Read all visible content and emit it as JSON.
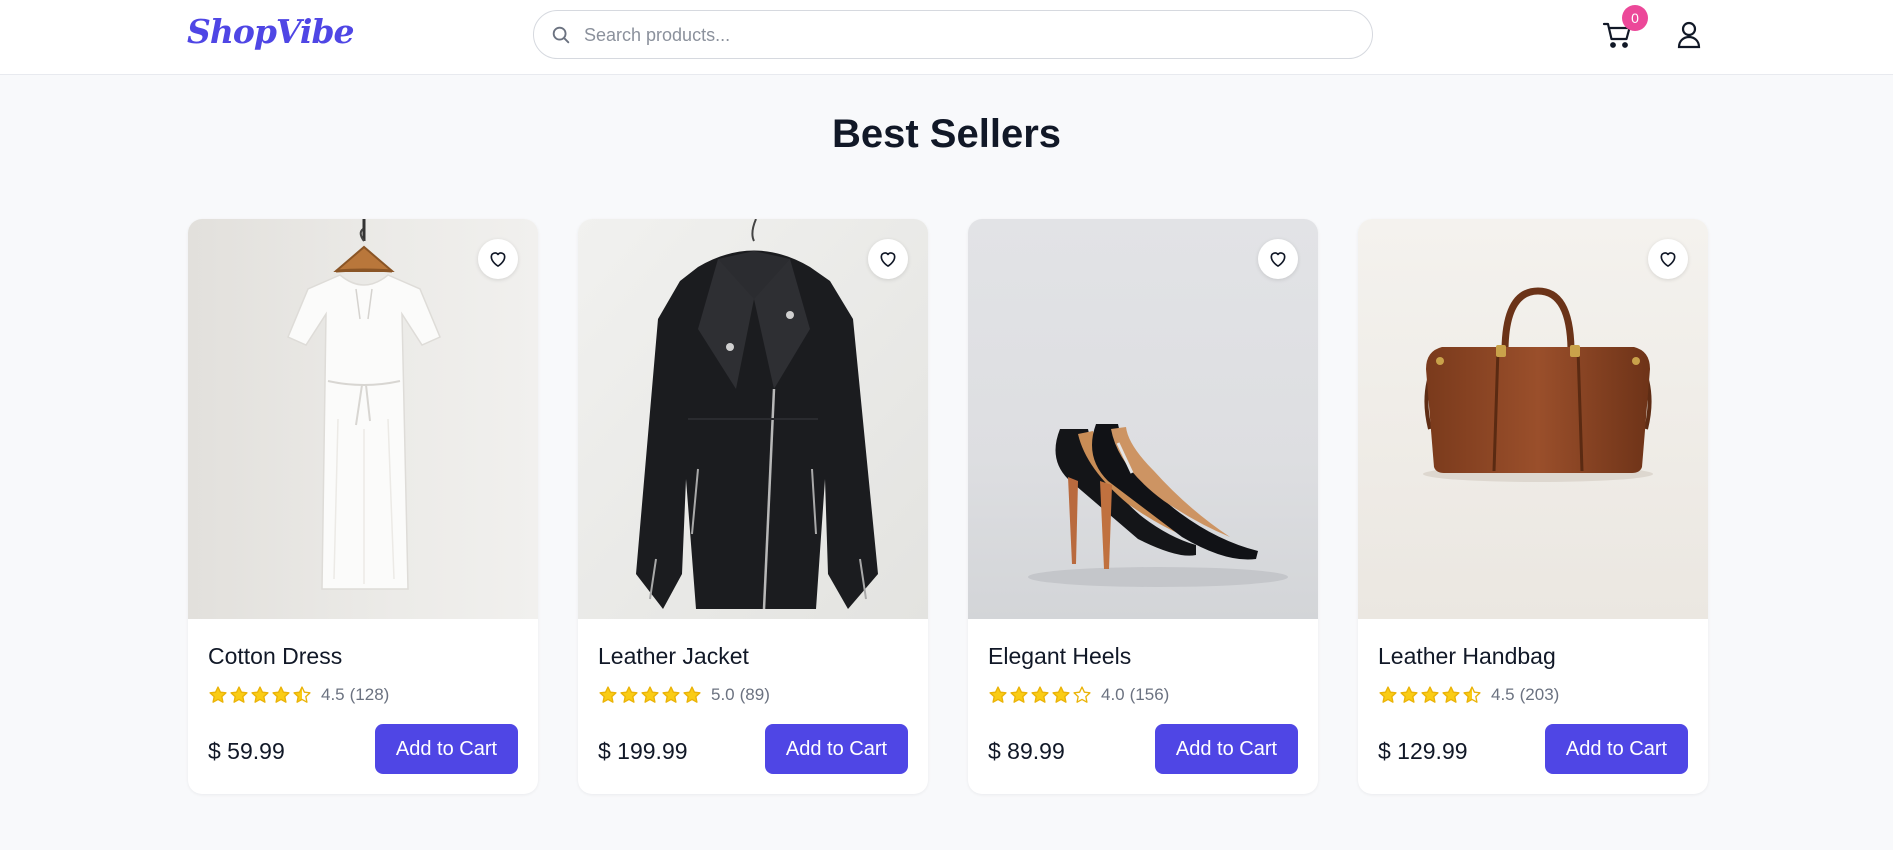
{
  "brand": {
    "logo": "ShopVibe",
    "accent": "#4f46e5",
    "badge_color": "#ec4899"
  },
  "search": {
    "placeholder": "Search products...",
    "value": "",
    "icon": "search-icon"
  },
  "header": {
    "cart_count": "0",
    "cart_icon": "cart-icon",
    "user_icon": "user-icon"
  },
  "main": {
    "title": "Best Sellers"
  },
  "products": [
    {
      "name": "Cotton Dress",
      "stars": 4.5,
      "rating": "4.5",
      "reviews": "(128)",
      "price": "$ 59.99",
      "button": "Add to Cart",
      "image": "white cotton dress on hanger"
    },
    {
      "name": "Leather Jacket",
      "stars": 5.0,
      "rating": "5.0",
      "reviews": "(89)",
      "price": "$ 199.99",
      "button": "Add to Cart",
      "image": "black leather jacket on hanger"
    },
    {
      "name": "Elegant Heels",
      "stars": 4.0,
      "rating": "4.0",
      "reviews": "(156)",
      "price": "$ 89.99",
      "button": "Add to Cart",
      "image": "black stiletto heels"
    },
    {
      "name": "Leather Handbag",
      "stars": 4.5,
      "rating": "4.5",
      "reviews": "(203)",
      "price": "$ 129.99",
      "button": "Add to Cart",
      "image": "brown leather handbag"
    }
  ]
}
